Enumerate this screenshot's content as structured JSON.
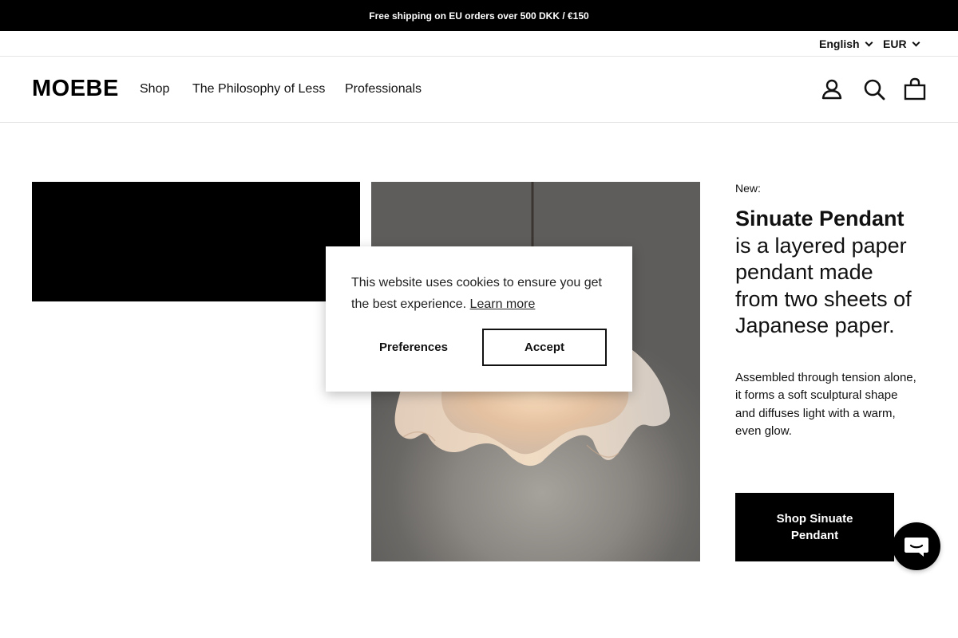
{
  "announcement": {
    "text": "Free shipping on EU orders over 500 DKK / €150"
  },
  "utility": {
    "language": "English",
    "currency": "EUR"
  },
  "header": {
    "logo": "MOEBE",
    "nav": [
      {
        "label": "Shop"
      },
      {
        "label": "The Philosophy of Less"
      },
      {
        "label": "Professionals"
      }
    ],
    "icons": [
      "account-icon",
      "search-icon",
      "cart-icon"
    ]
  },
  "hero": {
    "eyebrow": "New:",
    "product_name": "Sinuate Pendant",
    "headline_rest": "is a layered paper pendant made from two sheets of Japanese paper.",
    "body": "Assembled through tension alone, it forms a soft sculptural shape and diffuses light with a warm, even glow.",
    "cta": "Shop Sinuate Pendant"
  },
  "cookie_banner": {
    "message": "This website uses cookies to ensure you get the best experience.",
    "learn_more": "Learn more",
    "preferences": "Preferences",
    "accept": "Accept"
  },
  "chat": {
    "icon": "chat-icon"
  },
  "colors": {
    "announcement_bg": "#000000",
    "cta_bg": "#000000",
    "photo_bg": "#6b6966"
  }
}
